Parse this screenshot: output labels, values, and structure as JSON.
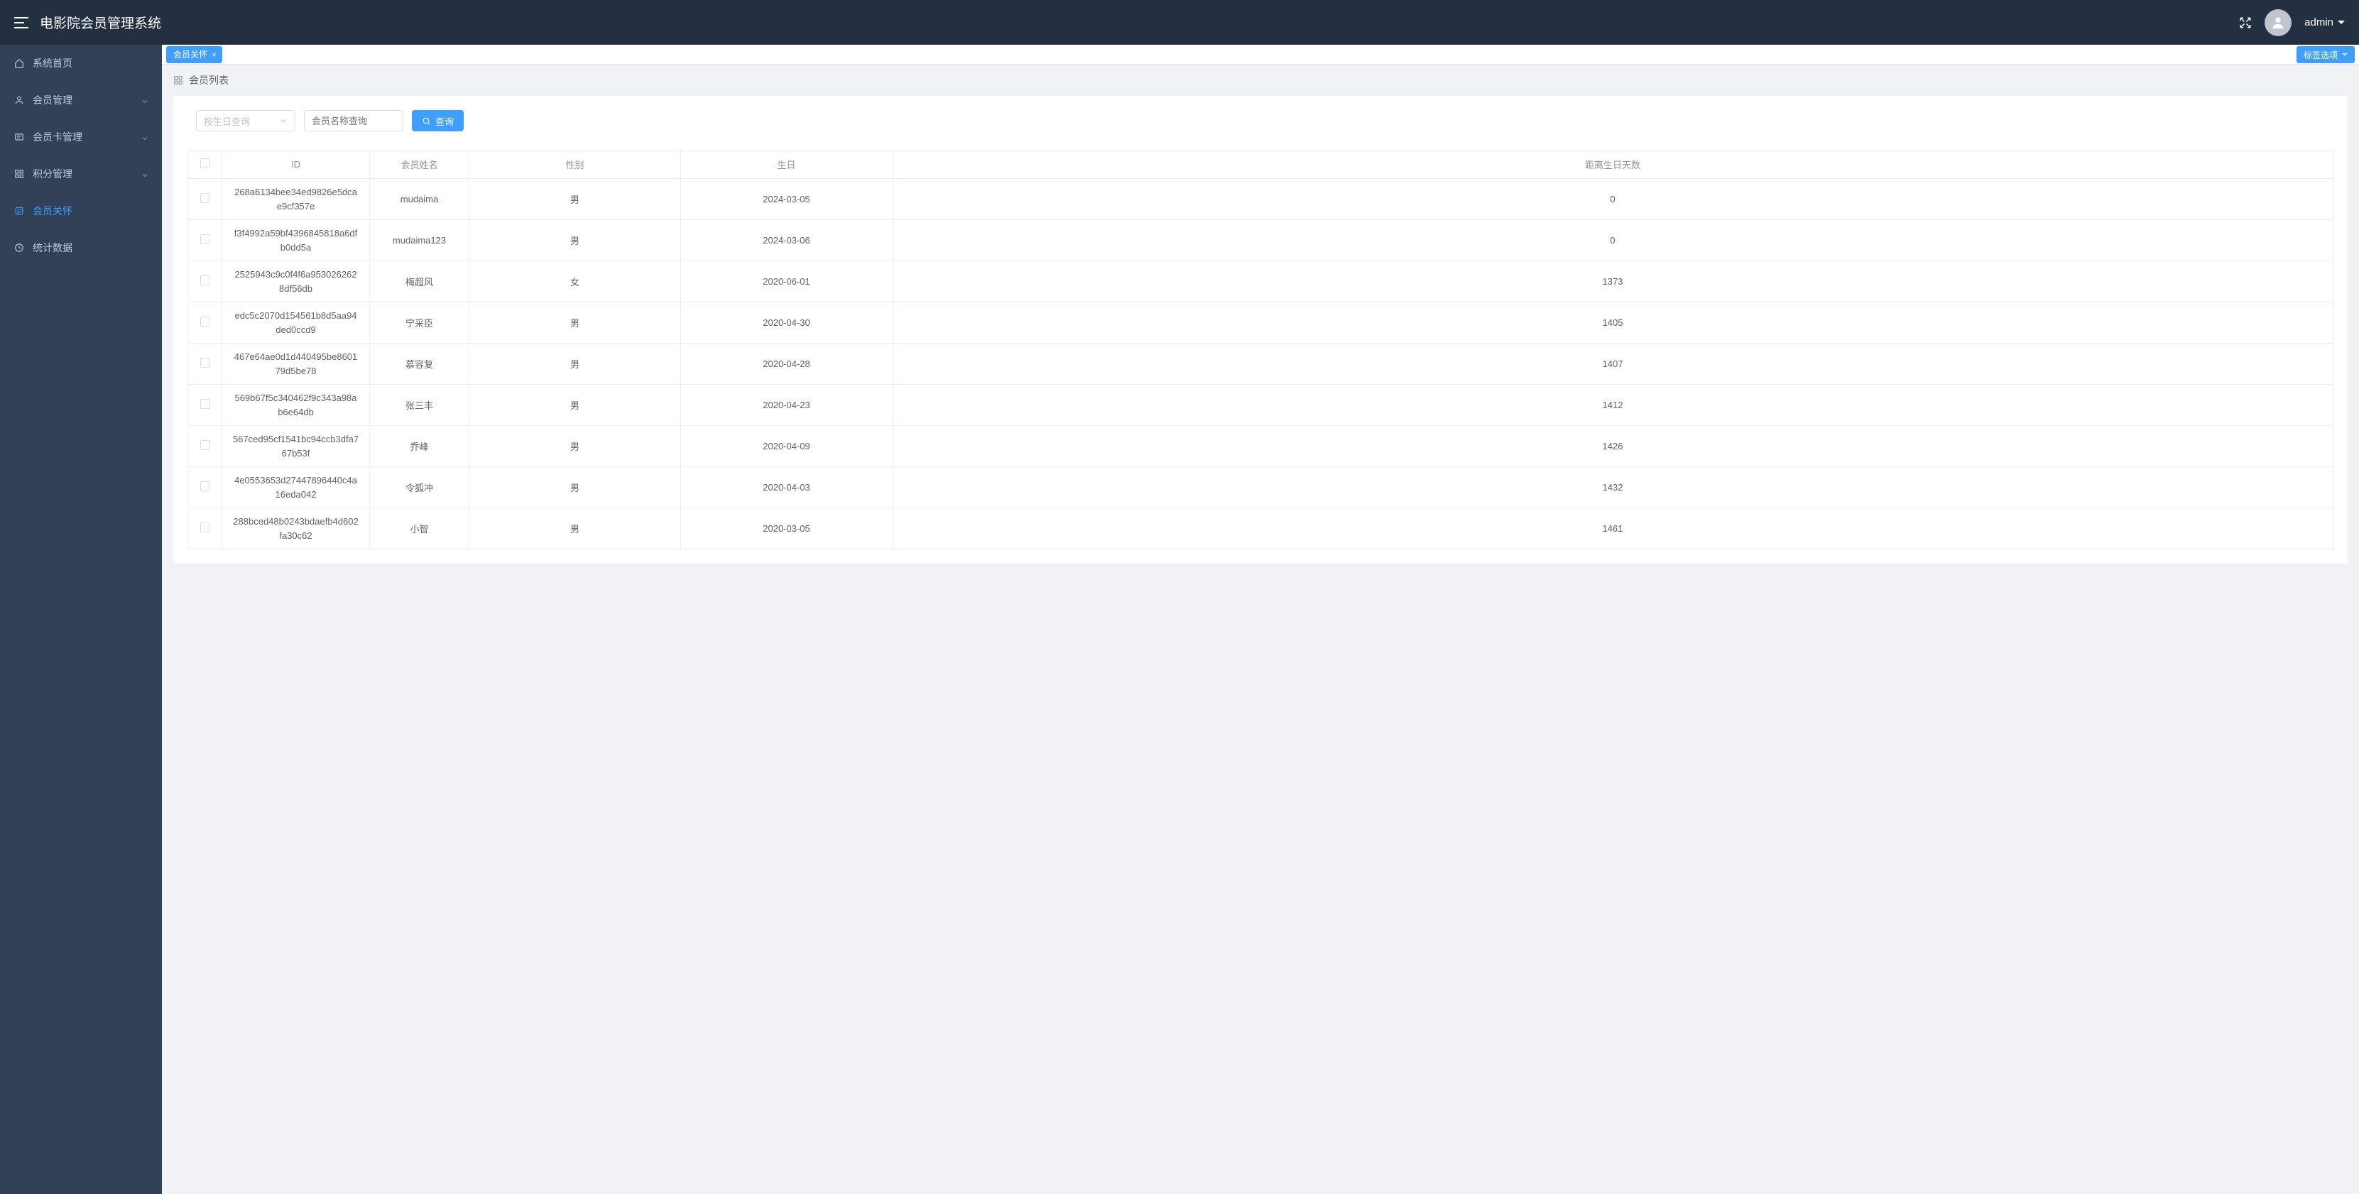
{
  "header": {
    "title": "电影院会员管理系统",
    "username": "admin"
  },
  "sidebar": {
    "items": [
      {
        "label": "系统首页",
        "key": "home",
        "active": false,
        "hasChildren": false
      },
      {
        "label": "会员管理",
        "key": "member",
        "active": false,
        "hasChildren": true
      },
      {
        "label": "会员卡管理",
        "key": "card",
        "active": false,
        "hasChildren": true
      },
      {
        "label": "积分管理",
        "key": "points",
        "active": false,
        "hasChildren": true
      },
      {
        "label": "会员关怀",
        "key": "care",
        "active": true,
        "hasChildren": false
      },
      {
        "label": "统计数据",
        "key": "stats",
        "active": false,
        "hasChildren": false
      }
    ]
  },
  "tabs": {
    "items": [
      {
        "label": "会员关怀"
      }
    ],
    "options_label": "标签选项"
  },
  "breadcrumb": {
    "label": "会员列表"
  },
  "filters": {
    "birthday_placeholder": "按生日查询",
    "name_placeholder": "会员名称查询",
    "search_label": "查询"
  },
  "table": {
    "columns": {
      "id": "ID",
      "name": "会员姓名",
      "gender": "性别",
      "birthday": "生日",
      "days": "距离生日天数"
    },
    "rows": [
      {
        "id": "268a6134bee34ed9826e5dcae9cf357e",
        "name": "mudaima",
        "gender": "男",
        "birthday": "2024-03-05",
        "days": "0"
      },
      {
        "id": "f3f4992a59bf4396845818a6dfb0dd5a",
        "name": "mudaima123",
        "gender": "男",
        "birthday": "2024-03-06",
        "days": "0"
      },
      {
        "id": "2525943c9c0f4f6a9530262628df56db",
        "name": "梅超风",
        "gender": "女",
        "birthday": "2020-06-01",
        "days": "1373"
      },
      {
        "id": "edc5c2070d154561b8d5aa94ded0ccd9",
        "name": "宁采臣",
        "gender": "男",
        "birthday": "2020-04-30",
        "days": "1405"
      },
      {
        "id": "467e64ae0d1d440495be860179d5be78",
        "name": "慕容复",
        "gender": "男",
        "birthday": "2020-04-28",
        "days": "1407"
      },
      {
        "id": "569b67f5c340462f9c343a98ab6e64db",
        "name": "张三丰",
        "gender": "男",
        "birthday": "2020-04-23",
        "days": "1412"
      },
      {
        "id": "567ced95cf1541bc94ccb3dfa767b53f",
        "name": "乔峰",
        "gender": "男",
        "birthday": "2020-04-09",
        "days": "1426"
      },
      {
        "id": "4e0553653d27447896440c4a16eda042",
        "name": "令狐冲",
        "gender": "男",
        "birthday": "2020-04-03",
        "days": "1432"
      },
      {
        "id": "288bced48b0243bdaefb4d602fa30c62",
        "name": "小智",
        "gender": "男",
        "birthday": "2020-03-05",
        "days": "1461"
      }
    ]
  }
}
